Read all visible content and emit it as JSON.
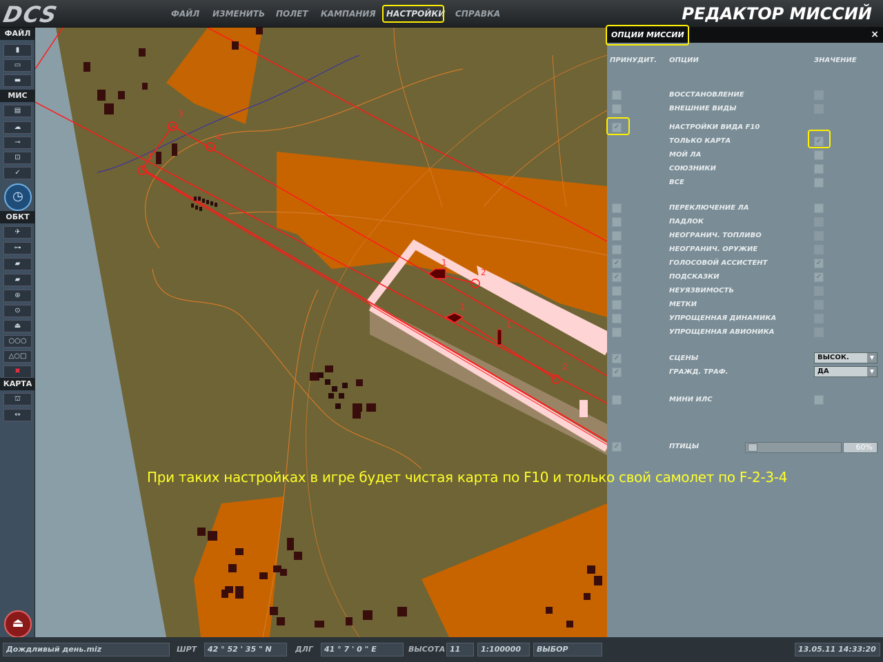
{
  "app": {
    "logo": "DCS",
    "title": "РЕДАКТОР МИССИЙ"
  },
  "menu": [
    "ФАЙЛ",
    "ИЗМЕНИТЬ",
    "ПОЛЕТ",
    "КАМПАНИЯ",
    "НАСТРОЙКИ",
    "СПРАВКА"
  ],
  "toolbar": {
    "sections": [
      "ФАЙЛ",
      "МИС",
      "ОБКТ",
      "КАРТА"
    ],
    "file_buttons": [
      "new-file-icon",
      "open-folder-icon",
      "save-icon"
    ],
    "mission_buttons": [
      "briefing-icon",
      "weather-icon",
      "trigger-icon",
      "goals-icon",
      "check-icon"
    ],
    "object_buttons": [
      "plane-icon",
      "helicopter-icon",
      "ship-icon",
      "vehicle-icon",
      "armor-icon",
      "static-icon",
      "ship2-icon",
      "group-icon",
      "shapes-icon",
      "delete-icon"
    ],
    "map_buttons": [
      "binoculars-icon",
      "ruler-icon"
    ]
  },
  "panel": {
    "title": "ОПЦИИ МИССИИ",
    "close": "×",
    "col_force": "ПРИНУДИТ.",
    "col_options": "ОПЦИИ",
    "col_value": "ЗНАЧЕНИЕ",
    "options": [
      {
        "label": "ВОССТАНОВЛЕНИЕ",
        "force": false,
        "value": false
      },
      {
        "label": "ВНЕШНИЕ ВИДЫ",
        "force": false,
        "value": false
      },
      {
        "label": "НАСТРОЙКИ ВИДА F10",
        "force": true
      },
      {
        "label": "ТОЛЬКО КАРТА",
        "value": true
      },
      {
        "label": "МОЙ ЛА",
        "value": false
      },
      {
        "label": "СОЮЗНИКИ",
        "value": false
      },
      {
        "label": "ВСЕ",
        "value": false
      },
      {
        "label": "ПЕРЕКЛЮЧЕНИЕ ЛА",
        "force": false,
        "value": false
      },
      {
        "label": "ПАДЛОК",
        "force": false,
        "value": false
      },
      {
        "label": "НЕОГРАНИЧ. ТОПЛИВО",
        "force": false,
        "value": false
      },
      {
        "label": "НЕОГРАНИЧ. ОРУЖИЕ",
        "force": false,
        "value": false
      },
      {
        "label": "ГОЛОСОВОЙ АССИСТЕНТ",
        "force": true,
        "value": true
      },
      {
        "label": "ПОДСКАЗКИ",
        "force": true,
        "value": true
      },
      {
        "label": "НЕУЯЗВИМОСТЬ",
        "force": false,
        "value": false
      },
      {
        "label": "МЕТКИ",
        "force": false,
        "value": false
      },
      {
        "label": "УПРОЩЕННАЯ ДИНАМИКА",
        "force": false,
        "value": false
      },
      {
        "label": "УПРОЩЕННАЯ АВИОНИКА",
        "force": false,
        "value": false
      },
      {
        "label": "СЦЕНЫ",
        "force": true,
        "select": "ВЫСОК."
      },
      {
        "label": "ГРАЖД. ТРАФ.",
        "force": true,
        "select": "ДА"
      },
      {
        "label": "МИНИ ИЛС",
        "force": false,
        "value": false
      },
      {
        "label": "ПТИЦЫ",
        "force": true,
        "slider": "60%"
      }
    ]
  },
  "map": {
    "waypoints_a": [
      "1",
      "2",
      "3",
      "4"
    ],
    "waypoints_b": [
      "1",
      "2"
    ],
    "waypoints_c": [
      "1",
      "1",
      "2"
    ]
  },
  "caption": "При таких настройках в игре будет чистая карта по F10 и только свой самолет по F-2-3-4",
  "statusbar": {
    "filename": "Дождливый день.miz",
    "lat_label": "ШРТ",
    "lat": "42 ° 52 ' 35 \" N",
    "lon_label": "ДЛГ",
    "lon": "41 ° 7 ' 0 \" E",
    "alt_label": "ВЫСОТА",
    "alt": "11",
    "scale": "1:100000",
    "mode": "ВЫБОР",
    "datetime": "13.05.11 14:33:20"
  },
  "colors": {
    "terrain": "#6e6435",
    "orange_zone": "#c86400",
    "route": "#ff1a1a",
    "runway": "#ffd4d4",
    "highlight": "#ffef00",
    "caption": "#ffff2a"
  }
}
